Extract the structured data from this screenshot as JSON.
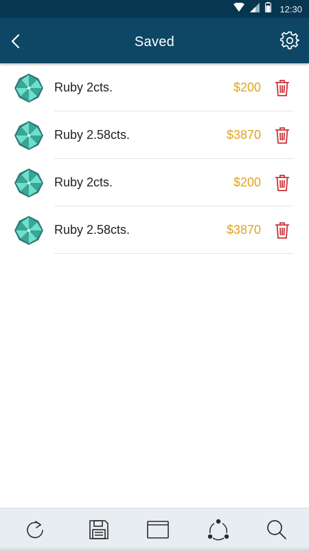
{
  "status_bar": {
    "time": "12:30",
    "icons": [
      "wifi-icon",
      "signal-icon",
      "battery-icon"
    ]
  },
  "header": {
    "title": "Saved",
    "back_icon": "chevron-left-icon",
    "settings_icon": "gear-icon"
  },
  "items": [
    {
      "name": "Ruby 2cts.",
      "price": "$200",
      "icon": "gem-icon",
      "action_icon": "trash-icon"
    },
    {
      "name": "Ruby 2.58cts.",
      "price": "$3870",
      "icon": "gem-icon",
      "action_icon": "trash-icon"
    },
    {
      "name": "Ruby 2cts.",
      "price": "$200",
      "icon": "gem-icon",
      "action_icon": "trash-icon"
    },
    {
      "name": "Ruby 2.58cts.",
      "price": "$3870",
      "icon": "gem-icon",
      "action_icon": "trash-icon"
    }
  ],
  "bottom_nav": [
    "refresh-icon",
    "save-icon",
    "folder-icon",
    "share-icon",
    "search-icon"
  ],
  "colors": {
    "status_bar": "#073651",
    "app_bar": "#0e4765",
    "price": "#e0a41f",
    "trash": "#c8323a",
    "gem_light": "#5fd6c3",
    "gem_dark": "#2c7a72",
    "bottom_bar": "#e8edf2"
  }
}
